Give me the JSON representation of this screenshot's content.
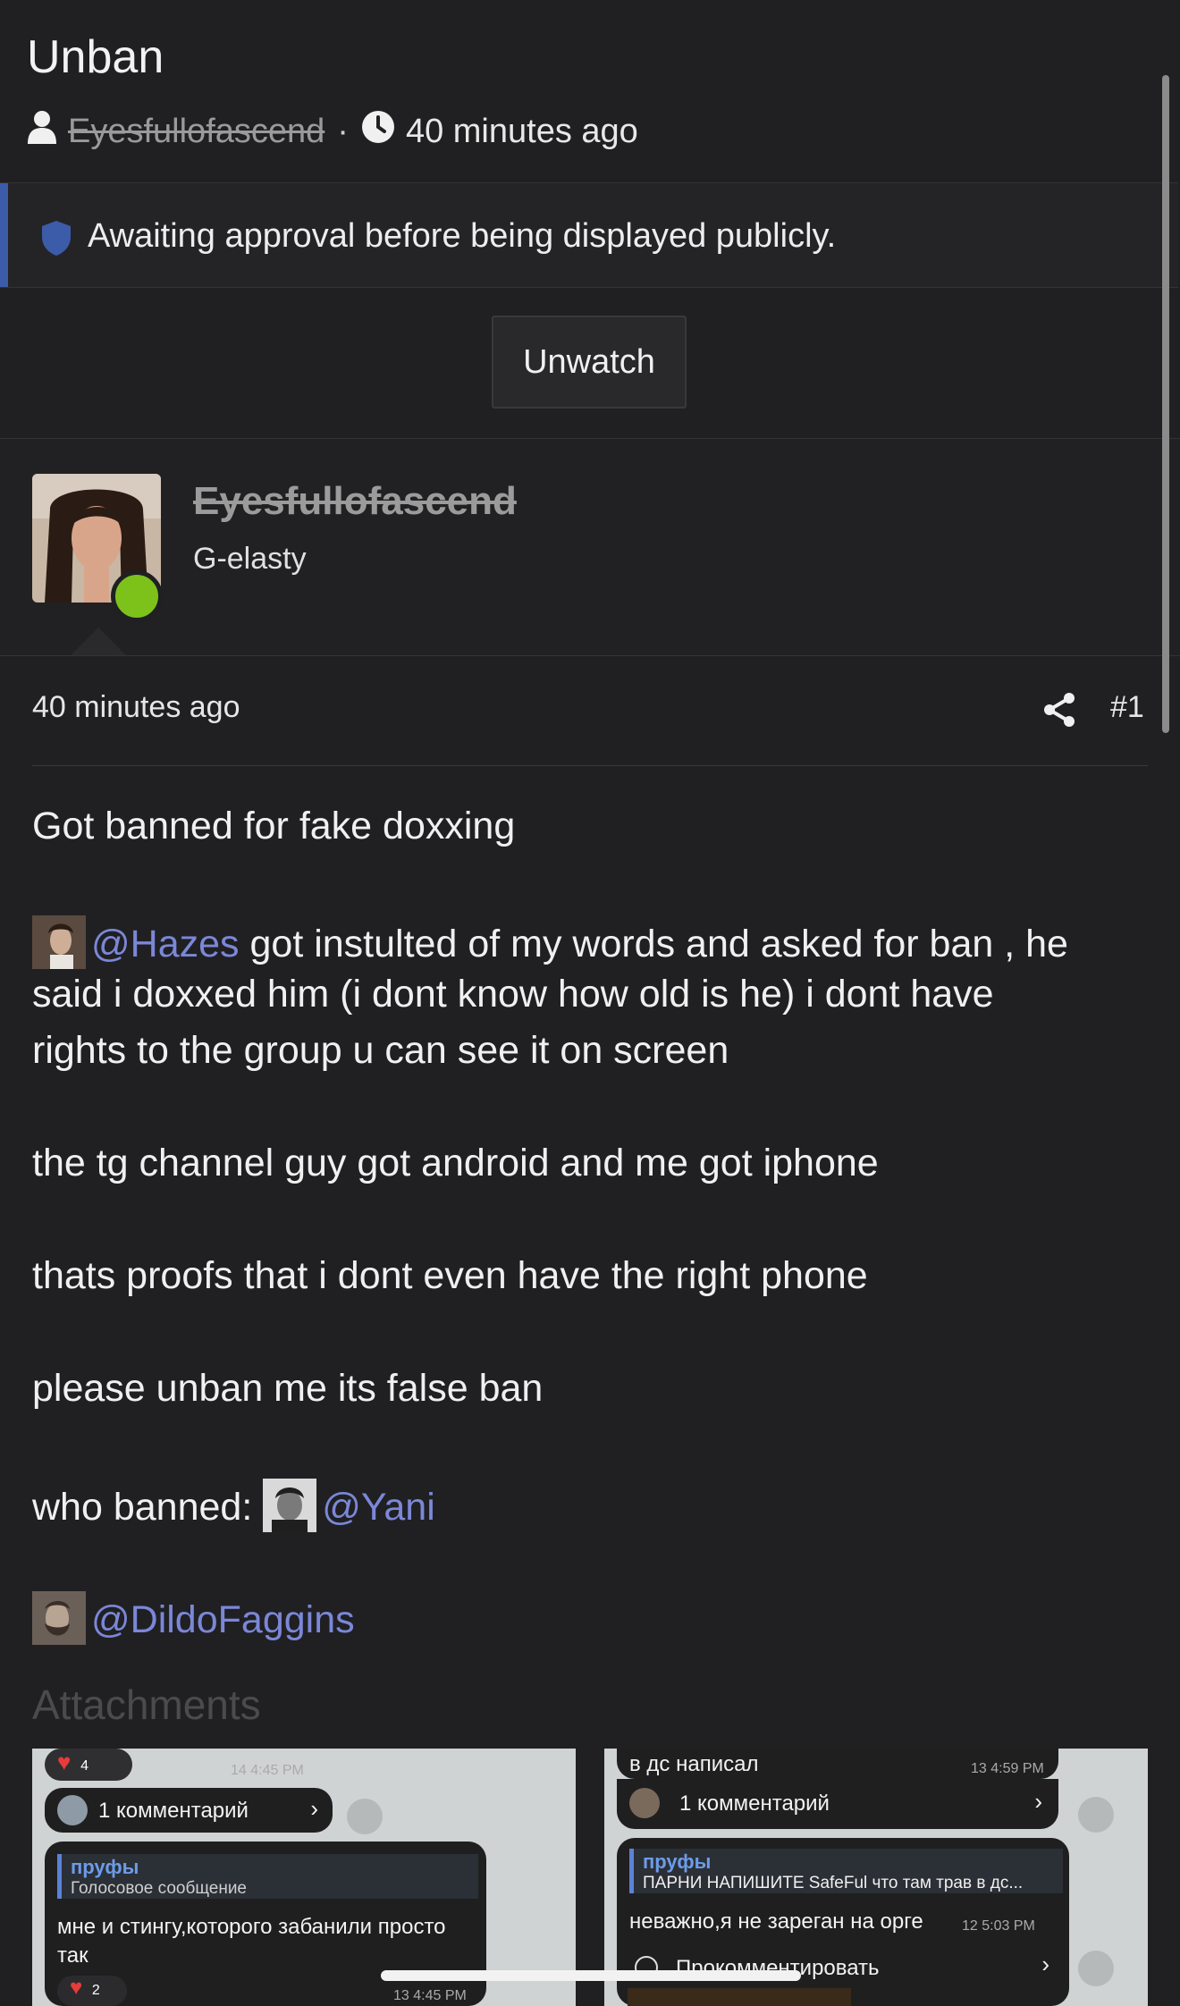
{
  "thread": {
    "title": "Unban",
    "author": "Eyesfullofascend",
    "separator": "·",
    "time": "40 minutes ago"
  },
  "notice": {
    "message": "Awaiting approval before being displayed publicly."
  },
  "actions": {
    "unwatch_label": "Unwatch"
  },
  "user": {
    "name": "Eyesfullofascend",
    "title": "G-elasty",
    "online": true
  },
  "post": {
    "time": "40 minutes ago",
    "number": "#1",
    "lines": {
      "l1": "Got banned for fake doxxing",
      "l2_mention": "@Hazes",
      "l2_rest": " got instulted of my words and asked for ban , he",
      "l3": "said i doxxed him (i dont know how old is he) i dont have",
      "l4": "rights to the group u can see it on screen",
      "l5": "the tg channel guy got android and me got iphone",
      "l6": "thats proofs that i dont even have the right phone",
      "l7": "please unban me its false ban",
      "l8_text": "who banned: ",
      "l8_mention": "@Yani",
      "l9_mention": "@DildoFaggins"
    },
    "attachments_heading": "Attachments"
  },
  "attachments": [
    {
      "reaction_count_top": "4",
      "time_top": "14 4:45 PM",
      "comments": "1 комментарий",
      "quote_title": "пруфы",
      "quote_sub": "Голосовое сообщение",
      "text_line1": "мне и стингу,которого забанили просто",
      "text_line2": "так",
      "reaction_count_bottom": "2",
      "time_bottom": "13 4:45 PM"
    },
    {
      "top_text": "в дс написал",
      "time_top": "13 4:59 PM",
      "comments": "1 комментарий",
      "quote_title": "пруфы",
      "quote_sub": "ПАРНИ НАПИШИТЕ SafeFul что там трав в дс...",
      "text_line1": "неважно,я не зареган на орге",
      "time_text": "12 5:03 PM",
      "comment_button": "Прокомментировать"
    }
  ],
  "colors": {
    "background": "#202022",
    "accent": "#3c5ba8",
    "mention": "#7b87d8",
    "online": "#7cc21b"
  }
}
